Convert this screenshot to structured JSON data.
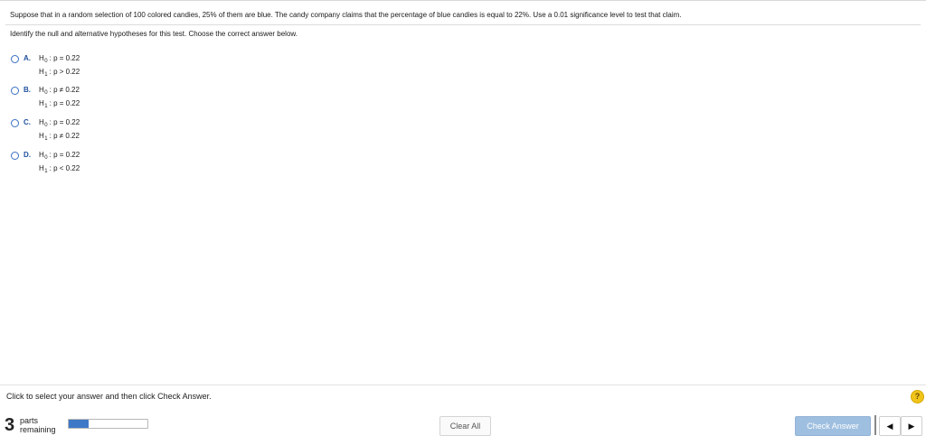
{
  "question": {
    "text": "Suppose that in a random selection of 100 colored candies, 25% of them are blue. The candy company claims that the percentage of blue candies is equal to 22%. Use a 0.01 significance level to test that claim.",
    "instruction": "Identify the null and alternative hypotheses for this test. Choose the correct answer below."
  },
  "choices": [
    {
      "letter": "A.",
      "h0": {
        "label": "H",
        "sub": "0",
        "stmt": ": p = 0.22"
      },
      "h1": {
        "label": "H",
        "sub": "1",
        "stmt": ": p > 0.22"
      }
    },
    {
      "letter": "B.",
      "h0": {
        "label": "H",
        "sub": "0",
        "stmt": ": p ≠ 0.22"
      },
      "h1": {
        "label": "H",
        "sub": "1",
        "stmt": ": p = 0.22"
      }
    },
    {
      "letter": "C.",
      "h0": {
        "label": "H",
        "sub": "0",
        "stmt": ": p = 0.22"
      },
      "h1": {
        "label": "H",
        "sub": "1",
        "stmt": ": p ≠ 0.22"
      }
    },
    {
      "letter": "D.",
      "h0": {
        "label": "H",
        "sub": "0",
        "stmt": ": p = 0.22"
      },
      "h1": {
        "label": "H",
        "sub": "1",
        "stmt": ": p < 0.22"
      }
    }
  ],
  "footer": {
    "status": "Click to select your answer and then click Check Answer.",
    "parts_count": "3",
    "parts_label_1": "parts",
    "parts_label_2": "remaining",
    "progress_fraction": 0.25,
    "clear_label": "Clear All",
    "check_label": "Check Answer",
    "help_glyph": "?",
    "prev_glyph": "◀",
    "next_glyph": "▶"
  },
  "colors": {
    "radio_border": "#3a6fc4",
    "letter": "#1f4f9e",
    "progress_fill": "#3e79c8",
    "check_button": "#9fbfe0",
    "help": "#f0c419"
  },
  "icons": {
    "help": "help-icon",
    "prev": "prev-arrow-icon",
    "next": "next-arrow-icon"
  }
}
